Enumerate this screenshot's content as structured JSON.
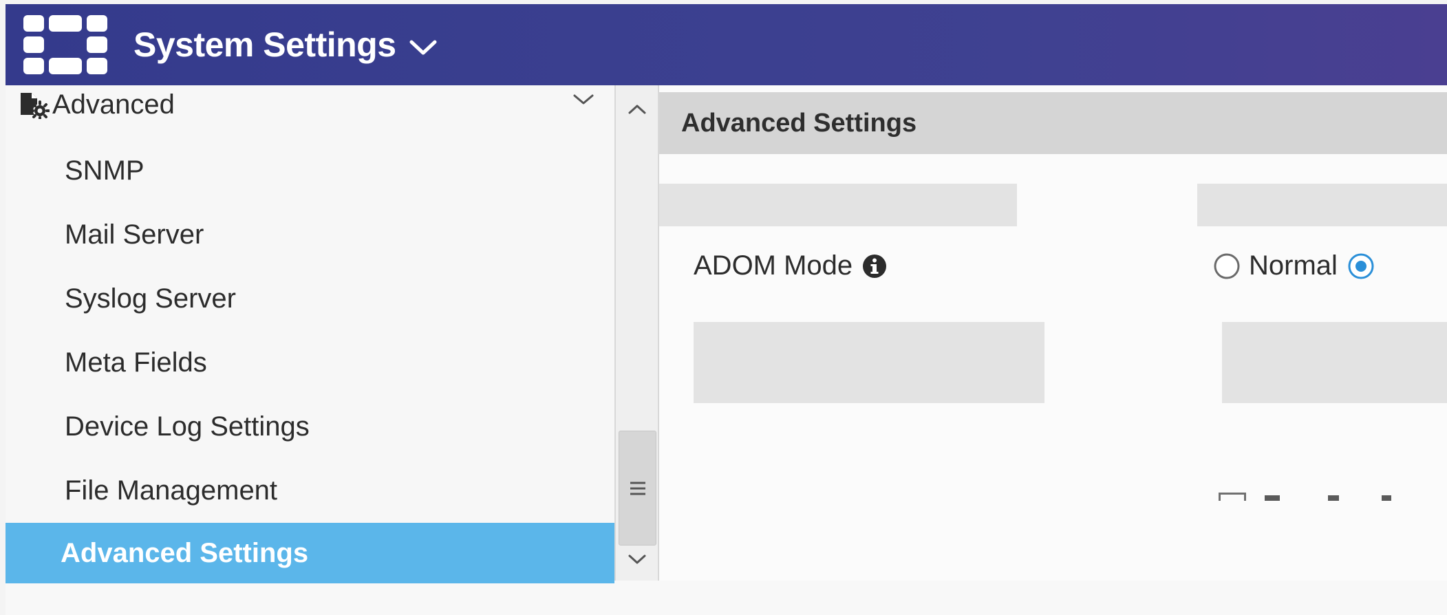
{
  "header": {
    "title": "System Settings",
    "logo_icon": "fortinet-logo-icon",
    "title_chevron_icon": "chevron-down-icon",
    "color": "#383d8e"
  },
  "sidebar": {
    "group": {
      "label": "Advanced",
      "icon": "advanced-settings-icon",
      "chevron_icon": "chevron-down-icon"
    },
    "items": [
      {
        "label": "SNMP",
        "active": false
      },
      {
        "label": "Mail Server",
        "active": false
      },
      {
        "label": "Syslog Server",
        "active": false
      },
      {
        "label": "Meta Fields",
        "active": false
      },
      {
        "label": "Device Log Settings",
        "active": false
      },
      {
        "label": "File Management",
        "active": false
      },
      {
        "label": "Advanced Settings",
        "active": true
      }
    ],
    "active_color": "#5bb6ea"
  },
  "scrollbar": {
    "up_icon": "chevron-up-icon",
    "down_icon": "chevron-down-icon",
    "grip_icon": "hamburger-grip-icon"
  },
  "main": {
    "title": "Advanced Settings",
    "adom_mode": {
      "label": "ADOM Mode",
      "info_icon": "info-icon",
      "options": [
        {
          "label": "Normal",
          "selected": false
        },
        {
          "label": "",
          "selected": true
        }
      ]
    }
  }
}
